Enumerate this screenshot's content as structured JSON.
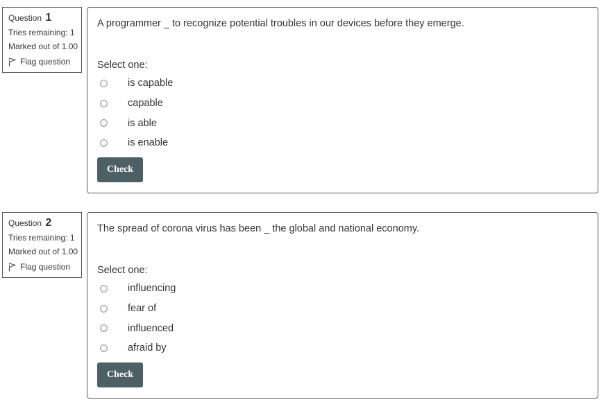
{
  "questions": [
    {
      "label": "Question",
      "number": "1",
      "tries": "Tries remaining: 1",
      "marked": "Marked out of 1.00",
      "flag": "Flag question",
      "text": "A programmer _ to recognize potential troubles in our devices before they emerge.",
      "prompt": "Select one:",
      "options": [
        "is capable",
        "capable",
        "is able",
        "is enable"
      ],
      "check": "Check"
    },
    {
      "label": "Question",
      "number": "2",
      "tries": "Tries remaining: 1",
      "marked": "Marked out of 1.00",
      "flag": "Flag question",
      "text": "The spread of corona virus has been _ the global and national economy.",
      "prompt": "Select one:",
      "options": [
        "influencing",
        "fear of",
        "influenced",
        "afraid by"
      ],
      "check": "Check"
    }
  ]
}
